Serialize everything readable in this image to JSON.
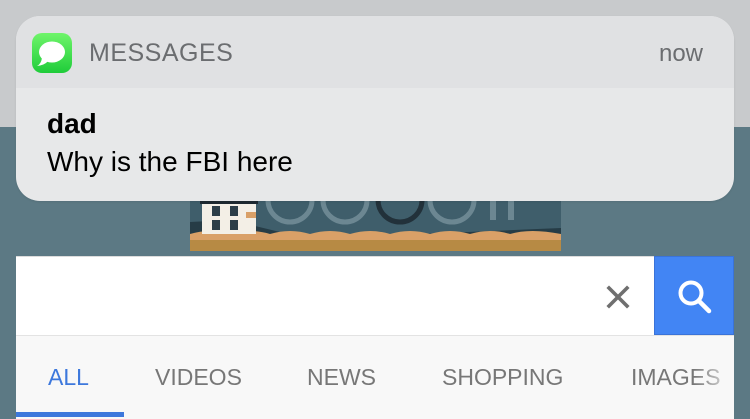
{
  "notification": {
    "app_name": "MESSAGES",
    "time": "now",
    "sender": "dad",
    "message": "Why is the FBI here",
    "icon": "messages-app-icon"
  },
  "search": {
    "value": "",
    "placeholder": "",
    "clear_icon": "close-icon",
    "submit_icon": "search-icon"
  },
  "tabs": [
    {
      "label": "ALL",
      "active": true
    },
    {
      "label": "VIDEOS",
      "active": false
    },
    {
      "label": "NEWS",
      "active": false
    },
    {
      "label": "SHOPPING",
      "active": false
    },
    {
      "label": "IMAGES",
      "active": false
    }
  ],
  "colors": {
    "accent": "#4285f4",
    "active_tab": "#3d78dc",
    "messages_green": "#34d34a",
    "background": "#5c7984"
  }
}
